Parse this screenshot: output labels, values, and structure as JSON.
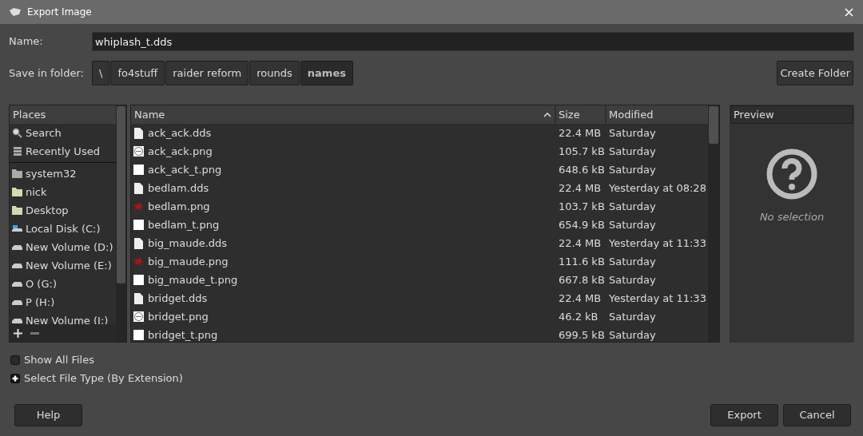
{
  "window": {
    "title": "Export Image"
  },
  "name_field": {
    "label": "Name:",
    "value": "whiplash_t.dds"
  },
  "folder": {
    "label": "Save in folder:",
    "path": [
      {
        "label": "\\",
        "selected": false
      },
      {
        "label": "fo4stuff",
        "selected": false
      },
      {
        "label": "raider reform",
        "selected": false
      },
      {
        "label": "rounds",
        "selected": false
      },
      {
        "label": "names",
        "selected": true
      }
    ],
    "create_button": "Create Folder"
  },
  "places": {
    "header": "Places",
    "groups": [
      [
        {
          "label": "Search",
          "kind": "search"
        },
        {
          "label": "Recently Used",
          "kind": "recent"
        }
      ],
      [
        {
          "label": "system32",
          "kind": "folder-grey"
        },
        {
          "label": "nick",
          "kind": "folder"
        },
        {
          "label": "Desktop",
          "kind": "folder"
        },
        {
          "label": "Local Disk (C:)",
          "kind": "system-drive"
        },
        {
          "label": "New Volume (D:)",
          "kind": "drive"
        },
        {
          "label": "New Volume (E:)",
          "kind": "drive"
        },
        {
          "label": "O (G:)",
          "kind": "drive"
        },
        {
          "label": "P (H:)",
          "kind": "drive"
        },
        {
          "label": "New Volume (I:)",
          "kind": "drive"
        }
      ]
    ]
  },
  "files": {
    "columns": [
      "Name",
      "Size",
      "Modified"
    ],
    "rows": [
      {
        "name": "ack_ack.dds",
        "kind": "doc",
        "size": "22.4 MB",
        "modified": "Saturday"
      },
      {
        "name": "ack_ack.png",
        "kind": "badge",
        "size": "105.7 kB",
        "modified": "Saturday"
      },
      {
        "name": "ack_ack_t.png",
        "kind": "blank",
        "size": "648.6 kB",
        "modified": "Saturday"
      },
      {
        "name": "bedlam.dds",
        "kind": "doc",
        "size": "22.4 MB",
        "modified": "Yesterday at 08:28"
      },
      {
        "name": "bedlam.png",
        "kind": "splat",
        "size": "103.7 kB",
        "modified": "Saturday"
      },
      {
        "name": "bedlam_t.png",
        "kind": "blank",
        "size": "654.9 kB",
        "modified": "Saturday"
      },
      {
        "name": "big_maude.dds",
        "kind": "doc",
        "size": "22.4 MB",
        "modified": "Yesterday at 11:33"
      },
      {
        "name": "big_maude.png",
        "kind": "splat",
        "size": "111.6 kB",
        "modified": "Saturday"
      },
      {
        "name": "big_maude_t.png",
        "kind": "blank",
        "size": "667.8 kB",
        "modified": "Saturday"
      },
      {
        "name": "bridget.dds",
        "kind": "doc",
        "size": "22.4 MB",
        "modified": "Yesterday at 11:33"
      },
      {
        "name": "bridget.png",
        "kind": "badge",
        "size": "46.2 kB",
        "modified": "Saturday"
      },
      {
        "name": "bridget_t.png",
        "kind": "blank",
        "size": "699.5 kB",
        "modified": "Saturday"
      }
    ]
  },
  "preview": {
    "header": "Preview",
    "message": "No selection"
  },
  "show_all_files": {
    "label": "Show All Files",
    "checked": false
  },
  "file_type": {
    "label": "Select File Type (By Extension)",
    "expanded": false
  },
  "buttons": {
    "help": "Help",
    "export": "Export",
    "cancel": "Cancel"
  }
}
